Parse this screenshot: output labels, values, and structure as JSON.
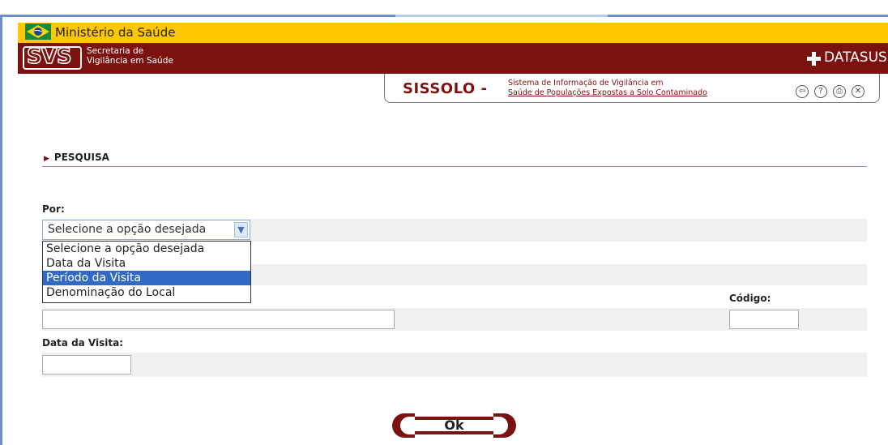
{
  "header": {
    "ministry": "Ministério da Saúde",
    "svs_logo": "SVS",
    "svs_line1": "Secretaria de",
    "svs_line2": "Vigilância em Saúde",
    "datasus": "DATASUS"
  },
  "system": {
    "name": "SISSOLO -",
    "desc_line1": "Sistema de Informação de Vigilância em",
    "desc_line2": "Saúde de Populações Expostas a Solo Contaminado",
    "icons": [
      "back-icon",
      "help-icon",
      "print-icon",
      "close-icon"
    ],
    "icon_glyphs": [
      "⇦",
      "?",
      "⎙",
      "✕"
    ]
  },
  "section": {
    "title": "PESQUISA"
  },
  "form": {
    "por_label": "Por:",
    "select_value": "Selecione a opção desejada",
    "options": [
      "Selecione a opção desejada",
      "Data da Visita",
      "Período da Visita",
      "Denominação do Local"
    ],
    "highlighted_option": "Período da Visita",
    "codigo_label": "Código:",
    "data_visita_label": "Data da Visita:",
    "denominacao_value": "",
    "codigo_value": "",
    "data_visita_value": ""
  },
  "actions": {
    "ok_label": "Ok"
  },
  "colors": {
    "ministry_bar": "#fec800",
    "brand_dark_red": "#7c1210",
    "selection": "#316ac5"
  }
}
